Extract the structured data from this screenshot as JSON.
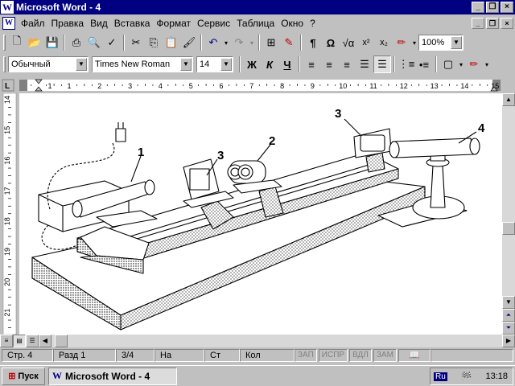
{
  "window": {
    "title": "Microsoft Word - 4",
    "app_icon": "W"
  },
  "menu": {
    "items": [
      "Файл",
      "Правка",
      "Вид",
      "Вставка",
      "Формат",
      "Сервис",
      "Таблица",
      "Окно",
      "?"
    ]
  },
  "toolbar": {
    "zoom": "100%"
  },
  "format_bar": {
    "style": "Обычный",
    "font": "Times New Roman",
    "size": "14",
    "bold": "Ж",
    "italic": "К",
    "underline": "Ч"
  },
  "ruler": {
    "h_ticks": [
      "1",
      "1",
      "2",
      "3",
      "4",
      "5",
      "6",
      "7",
      "8",
      "9",
      "10",
      "11",
      "12",
      "13",
      "14",
      "15"
    ],
    "v_ticks": [
      "14",
      "15",
      "16",
      "17",
      "18",
      "19",
      "20",
      "21"
    ]
  },
  "figure": {
    "labels": [
      "1",
      "3",
      "2",
      "3",
      "4"
    ]
  },
  "status": {
    "page": "Стр. 4",
    "section": "Разд 1",
    "pages": "3/4",
    "at": "На",
    "line": "Ст",
    "col": "Кол",
    "modes": [
      "ЗАП",
      "ИСПР",
      "ВДЛ",
      "ЗАМ"
    ]
  },
  "taskbar": {
    "start": "Пуск",
    "task": "Microsoft Word - 4",
    "lang": "Ru",
    "time": "13:18"
  }
}
